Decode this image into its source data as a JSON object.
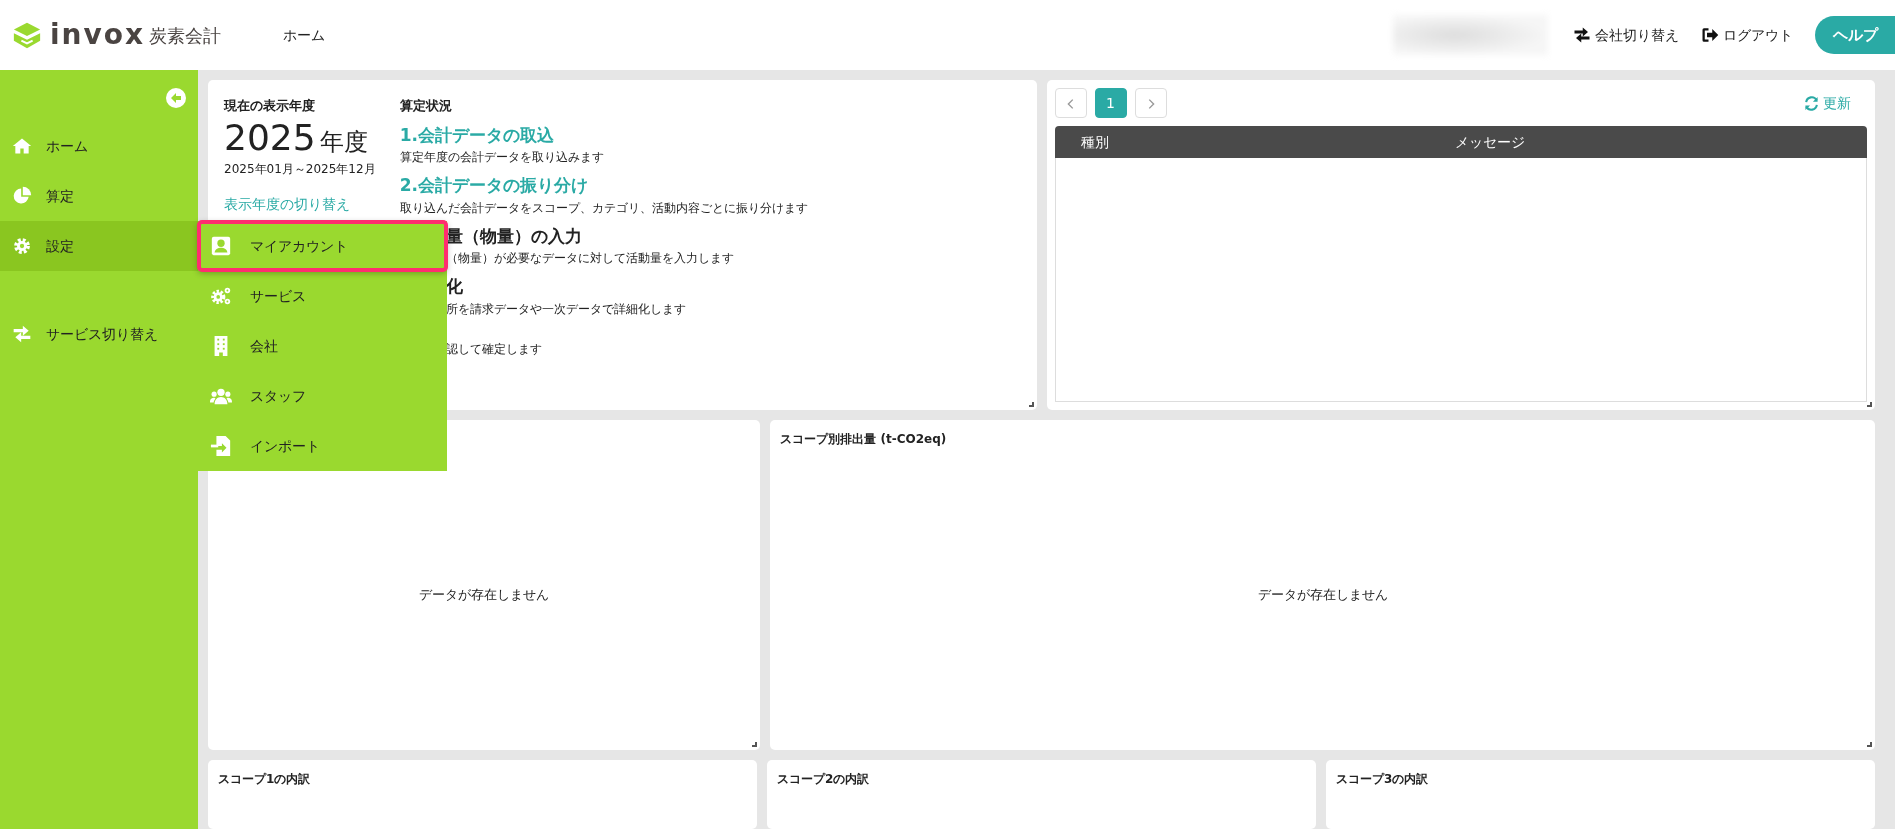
{
  "header": {
    "logo_text": "invox",
    "logo_subtext": "炭素会計",
    "nav": [
      {
        "label": "ホーム"
      }
    ],
    "actions": [
      {
        "kind": "switch",
        "label": "会社切り替え"
      },
      {
        "kind": "logout",
        "label": "ログアウト"
      }
    ],
    "help_button": "ヘルプ"
  },
  "sidebar": {
    "items": [
      {
        "kind": "home",
        "label": "ホーム",
        "selected": false
      },
      {
        "kind": "chart",
        "label": "算定",
        "selected": false
      },
      {
        "kind": "gear",
        "label": "設定",
        "selected": true
      },
      {
        "kind": "switch",
        "label": "サービス切り替え",
        "selected": false
      }
    ]
  },
  "submenu": {
    "items": [
      {
        "kind": "account",
        "label": "マイアカウント",
        "selected": true
      },
      {
        "kind": "gears",
        "label": "サービス",
        "selected": false
      },
      {
        "kind": "building",
        "label": "会社",
        "selected": false
      },
      {
        "kind": "people",
        "label": "スタッフ",
        "selected": false
      },
      {
        "kind": "import",
        "label": "インポート",
        "selected": false
      }
    ]
  },
  "year_panel": {
    "title": "現在の表示年度",
    "year": "2025",
    "year_unit": "年度",
    "range": "2025年01月～2025年12月",
    "switch_link": "表示年度の切り替え"
  },
  "status": {
    "title": "算定状況",
    "steps": [
      {
        "kind": "full",
        "title": "1.会計データの取込",
        "description": "算定年度の会計データを取り込みます"
      },
      {
        "kind": "full",
        "title": "2.会計データの振り分け",
        "description": "取り込んだ会計データをスコープ、カテゴリ、活動内容ごとに振り分けます"
      },
      {
        "kind": "covered",
        "title": "量（物量）の入力",
        "description": "（物量）が必要なデータに対して活動量を入力します"
      },
      {
        "kind": "covered",
        "title": "化",
        "description": "所を請求データや一次データで詳細化します"
      },
      {
        "kind": "covered",
        "description": "認して確定します"
      }
    ]
  },
  "log_panel": {
    "pages": [
      {
        "label": "1",
        "selected": true
      }
    ],
    "refresh": "更新",
    "columns": [
      "種別",
      "メッセージ"
    ]
  },
  "middle_cards": [
    {
      "empty_text": "データが存在しません"
    },
    {
      "title": "スコープ別排出量 (t-CO2eq)",
      "empty_text": "データが存在しません"
    }
  ],
  "bottom_cards": [
    {
      "title": "スコープ1の内訳"
    },
    {
      "title": "スコープ2の内訳"
    },
    {
      "title": "スコープ3の内訳"
    }
  ]
}
